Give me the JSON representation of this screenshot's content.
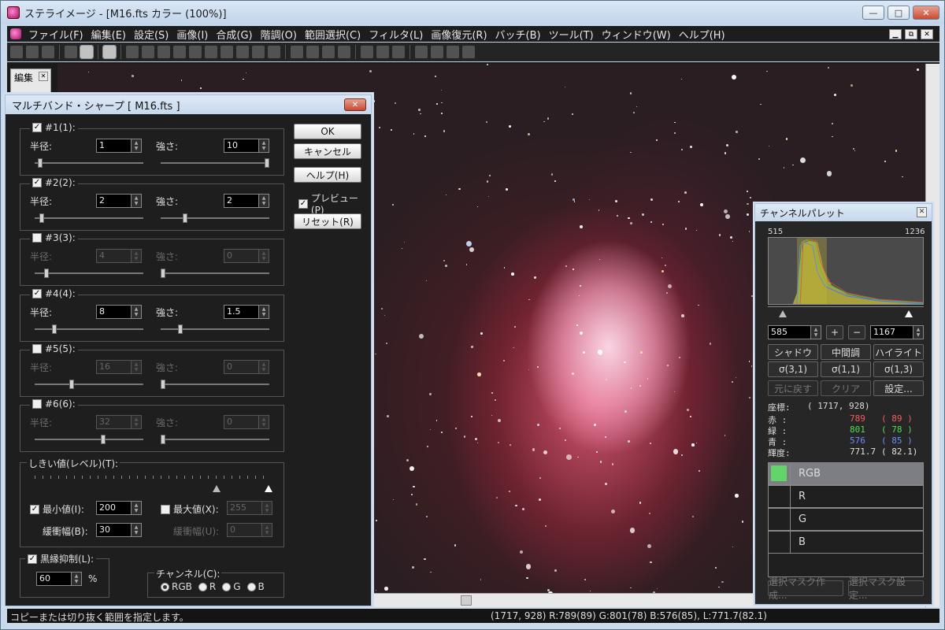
{
  "window": {
    "title": "ステライメージ - [M16.fts カラー (100%)]",
    "min": "—",
    "max": "□",
    "close": "✕"
  },
  "menu": [
    "ファイル(F)",
    "編集(E)",
    "設定(S)",
    "画像(I)",
    "合成(G)",
    "階調(O)",
    "範囲選択(C)",
    "フィルタ(L)",
    "画像復元(R)",
    "バッチ(B)",
    "ツール(T)",
    "ウィンドウ(W)",
    "ヘルプ(H)"
  ],
  "mdi": {
    "min": "▁",
    "restore": "⧉",
    "close": "✕"
  },
  "edit_panel": {
    "label": "編集",
    "close": "✕"
  },
  "dialog": {
    "title": "マルチバンド・シャープ [ M16.fts ]",
    "close": "✕",
    "radius_label": "半径:",
    "strength_label": "強さ:",
    "bands": [
      {
        "label": "#1(1):",
        "checked": true,
        "radius": "1",
        "strength": "10"
      },
      {
        "label": "#2(2):",
        "checked": true,
        "radius": "2",
        "strength": "2"
      },
      {
        "label": "#3(3):",
        "checked": false,
        "radius": "4",
        "strength": "0"
      },
      {
        "label": "#4(4):",
        "checked": true,
        "radius": "8",
        "strength": "1.5"
      },
      {
        "label": "#5(5):",
        "checked": false,
        "radius": "16",
        "strength": "0"
      },
      {
        "label": "#6(6):",
        "checked": false,
        "radius": "32",
        "strength": "0"
      }
    ],
    "buttons": {
      "ok": "OK",
      "cancel": "キャンセル",
      "help": "ヘルプ(H)",
      "reset": "リセット(R)"
    },
    "preview": {
      "label": "プレビュー(P)",
      "checked": true
    },
    "threshold": {
      "label": "しきい値(レベル)(T):",
      "min_label": "最小値(I):",
      "min_value": "200",
      "min_checked": true,
      "min_soft_label": "緩衝幅(B):",
      "min_soft_value": "30",
      "max_label": "最大値(X):",
      "max_value": "255",
      "max_checked": false,
      "max_soft_label": "緩衝幅(U):",
      "max_soft_value": "0"
    },
    "black_edge": {
      "label": "黒縁抑制(L):",
      "checked": true,
      "value": "60",
      "unit": "%"
    },
    "channel": {
      "label": "チャンネル(C):",
      "options": [
        "RGB",
        "R",
        "G",
        "B"
      ],
      "selected": "RGB"
    }
  },
  "channel_palette": {
    "title": "チャンネルパレット",
    "close": "✕",
    "hist_min": "515",
    "hist_max": "1236",
    "low_value": "585",
    "high_value": "1167",
    "plus": "+",
    "minus": "−",
    "buttons_row1": [
      "シャドウ",
      "中間調",
      "ハイライト"
    ],
    "buttons_row2": [
      "σ(3,1)",
      "σ(1,1)",
      "σ(1,3)"
    ],
    "buttons_row3": [
      "元に戻す",
      "クリア",
      "設定..."
    ],
    "coord_label": "座標:",
    "coord_value": "(   1717,    928)",
    "rows": [
      {
        "label": "赤  :",
        "value": "789",
        "sub": "(  89  )",
        "color": "#ff5a5a"
      },
      {
        "label": "緑  :",
        "value": "801",
        "sub": "(  78  )",
        "color": "#4ee04e"
      },
      {
        "label": "青  :",
        "value": "576",
        "sub": "(  85  )",
        "color": "#6a8cff"
      },
      {
        "label": "輝度:",
        "value": "771.7",
        "sub": "(  82.1)",
        "color": "#e0e0e0"
      }
    ],
    "channels": [
      "RGB",
      "R",
      "G",
      "B"
    ],
    "mask_create": "選択マスク作成...",
    "mask_settings": "選択マスク設定..."
  },
  "status": {
    "hint": "コピーまたは切り抜く範囲を指定します。",
    "pixel": "(1717, 928) R:789(89) G:801(78) B:576(85), L:771.7(82.1)"
  }
}
